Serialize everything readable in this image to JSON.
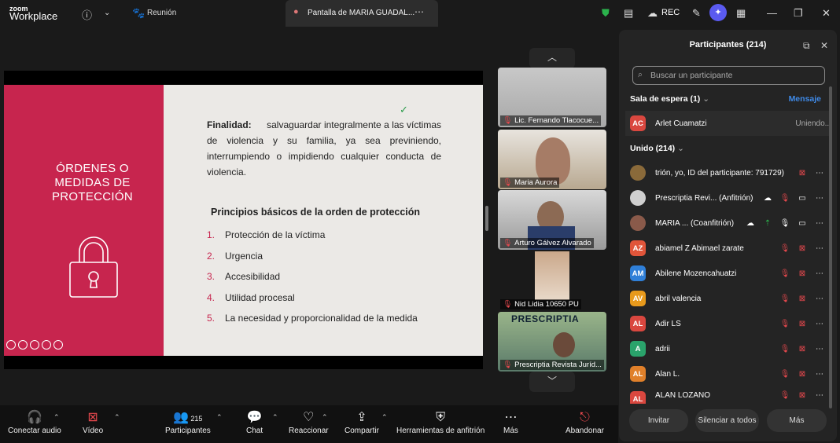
{
  "app": {
    "logo_top": "zoom",
    "logo_bottom": "Workplace",
    "meeting_label": "Reunión",
    "share_tab": "Pantalla de MARIA GUADAL...",
    "rec": "REC"
  },
  "slide": {
    "title": "ÓRDENES O MEDIDAS DE PROTECCIÓN",
    "finalidad_label": "Finalidad:",
    "finalidad_text": "salvaguardar integralmente a las víctimas de violencia y su familia, ya sea previniendo, interrumpiendo o impidiendo cualquier conducta de violencia.",
    "principios_title": "Principios básicos de la orden de protección",
    "principios": [
      {
        "n": "1.",
        "t": "Protección de la víctima"
      },
      {
        "n": "2.",
        "t": "Urgencia"
      },
      {
        "n": "3.",
        "t": "Accesibilidad"
      },
      {
        "n": "4.",
        "t": "Utilidad procesal"
      },
      {
        "n": "5.",
        "t": "La necesidad y proporcionalidad de la medida"
      }
    ]
  },
  "gallery": [
    {
      "name": "Lic. Fernando Tlacocue..."
    },
    {
      "name": "Maria Aurora"
    },
    {
      "name": "Arturo Gálvez Alvarado"
    },
    {
      "name": "Nid Lidia 10650 PU"
    },
    {
      "name": "Prescriptia Revista Juríd...",
      "banner": "PRESCRIPTIA"
    }
  ],
  "panel": {
    "title": "Participantes (214)",
    "search_placeholder": "Buscar un participante",
    "waiting_header": "Sala de espera (1)",
    "message_link": "Mensaje",
    "waiting": {
      "initials": "AC",
      "name": "Arlet Cuamatzi",
      "status": "Uniendo..."
    },
    "joined_header": "Unido (214)",
    "participants": [
      {
        "initials": "",
        "name": "trión, yo, ID del participante: 791729)",
        "color": "#8a6a3a"
      },
      {
        "initials": "",
        "name": "Prescriptia Revi... (Anfitrión)",
        "color": "#cfcfcf"
      },
      {
        "initials": "",
        "name": "MARIA ... (Coanfitrión)",
        "color": "#8a5a4a"
      },
      {
        "initials": "AZ",
        "name": "abiamel Z Abimael zarate",
        "color": "#e0553a"
      },
      {
        "initials": "AM",
        "name": "Abilene Mozencahuatzi",
        "color": "#2f7fd8"
      },
      {
        "initials": "AV",
        "name": "abril valencia",
        "color": "#e89a1c"
      },
      {
        "initials": "AL",
        "name": "Adir LS",
        "color": "#d9473f"
      },
      {
        "initials": "A",
        "name": "adrii",
        "color": "#2aa36b"
      },
      {
        "initials": "AL",
        "name": "Alan L.",
        "color": "#e0802a"
      },
      {
        "initials": "AL",
        "name": "ALAN LOZANO",
        "color": "#d9473f"
      }
    ],
    "buttons": {
      "invite": "Invitar",
      "mute_all": "Silenciar a todos",
      "more": "Más"
    }
  },
  "toolbar": {
    "audio": "Conectar audio",
    "video": "Vídeo",
    "participants": "Participantes",
    "participants_count": "215",
    "chat": "Chat",
    "react": "Reaccionar",
    "share": "Compartir",
    "host_tools": "Herramientas de anfitrión",
    "more": "Más",
    "leave": "Abandonar"
  }
}
